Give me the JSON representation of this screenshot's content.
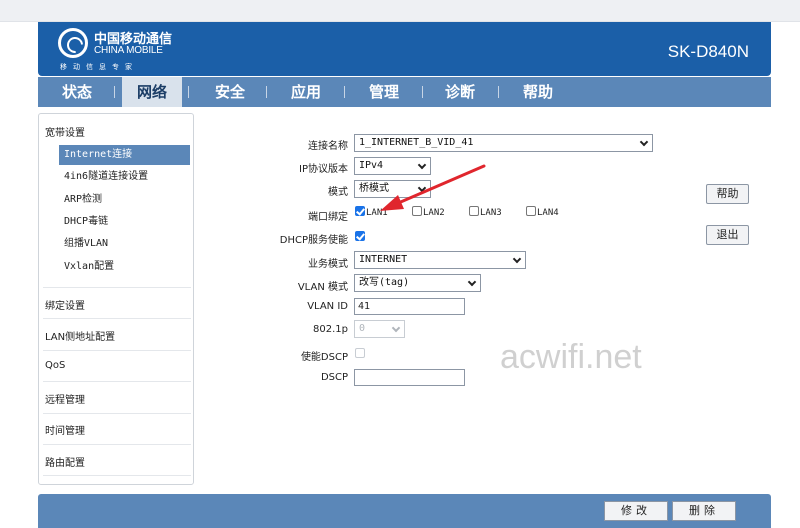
{
  "header": {
    "logo_cn": "中国移动通信",
    "logo_en": "CHINA MOBILE",
    "logo_sub": "移动信息专家",
    "model": "SK-D840N"
  },
  "nav": {
    "items": [
      {
        "label": "状态"
      },
      {
        "label": "网络"
      },
      {
        "label": "安全"
      },
      {
        "label": "应用"
      },
      {
        "label": "管理"
      },
      {
        "label": "诊断"
      },
      {
        "label": "帮助"
      }
    ],
    "active": "网络"
  },
  "sidebar": {
    "groups": [
      {
        "label": "宽带设置"
      },
      {
        "label": "绑定设置"
      },
      {
        "label": "LAN侧地址配置"
      },
      {
        "label": "QoS"
      },
      {
        "label": "远程管理"
      },
      {
        "label": "时间管理"
      },
      {
        "label": "路由配置"
      }
    ],
    "items": [
      {
        "label": "Internet连接"
      },
      {
        "label": "4in6隧道连接设置"
      },
      {
        "label": "ARP检测"
      },
      {
        "label": "DHCP毒链"
      },
      {
        "label": "组播VLAN"
      },
      {
        "label": "Vxlan配置"
      }
    ]
  },
  "form": {
    "connection_name_label": "连接名称",
    "connection_name_value": "1_INTERNET_B_VID_41",
    "ip_version_label": "IP协议版本",
    "ip_version_value": "IPv4",
    "mode_label": "模式",
    "mode_value": "桥模式",
    "port_bind_label": "端口绑定",
    "ports": [
      {
        "label": "LAN1",
        "checked": true
      },
      {
        "label": "LAN2",
        "checked": false
      },
      {
        "label": "LAN3",
        "checked": false
      },
      {
        "label": "LAN4",
        "checked": false
      }
    ],
    "dhcp_label": "DHCP服务使能",
    "dhcp_checked": true,
    "service_mode_label": "业务模式",
    "service_mode_value": "INTERNET",
    "vlan_mode_label": "VLAN 模式",
    "vlan_mode_value": "改写(tag)",
    "vlan_id_label": "VLAN ID",
    "vlan_id_value": "41",
    "dot1p_label": "802.1p",
    "dot1p_value": "0",
    "dscp_enable_label": "使能DSCP",
    "dscp_label": "DSCP",
    "dscp_value": ""
  },
  "actions": {
    "help_label": "帮助",
    "logout_label": "退出",
    "modify_label": "修改",
    "delete_label": "删除"
  },
  "watermark": "acwifi.net",
  "colors": {
    "header_blue": "#1b5fa8",
    "nav_blue": "#5b87b8",
    "annotation_red": "#e0262d",
    "checkbox_blue": "#1a73e8"
  }
}
